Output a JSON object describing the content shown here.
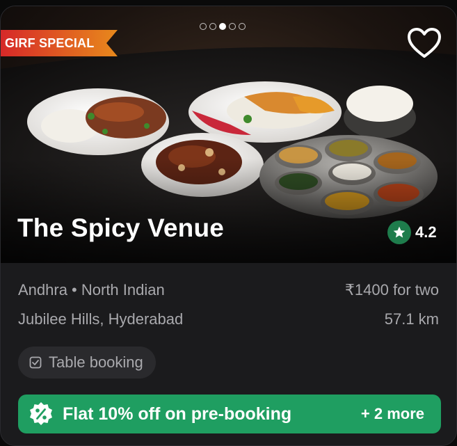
{
  "card": {
    "badge": "GIRF SPECIAL",
    "carousel": {
      "total": 5,
      "active_index": 2
    },
    "restaurant_name": "The Spicy Venue",
    "rating": "4.2",
    "cuisines": "Andhra • North Indian",
    "price": "₹1400 for two",
    "location": "Jubilee Hills, Hyderabad",
    "distance": "57.1 km",
    "chip_label": "Table booking",
    "offer_text": "Flat 10% off on pre-booking",
    "offer_more": "+ 2 more",
    "icons": {
      "favorite": "heart-outline-icon",
      "rating": "star-icon",
      "chip": "checkbox-icon",
      "offer": "percent-badge-icon"
    },
    "colors": {
      "badge_start": "#d62828",
      "badge_end": "#e8891c",
      "rating_bg": "#1e7c4c",
      "offer_bg": "#1f9e61",
      "card_bg": "#1b1b1d"
    }
  }
}
